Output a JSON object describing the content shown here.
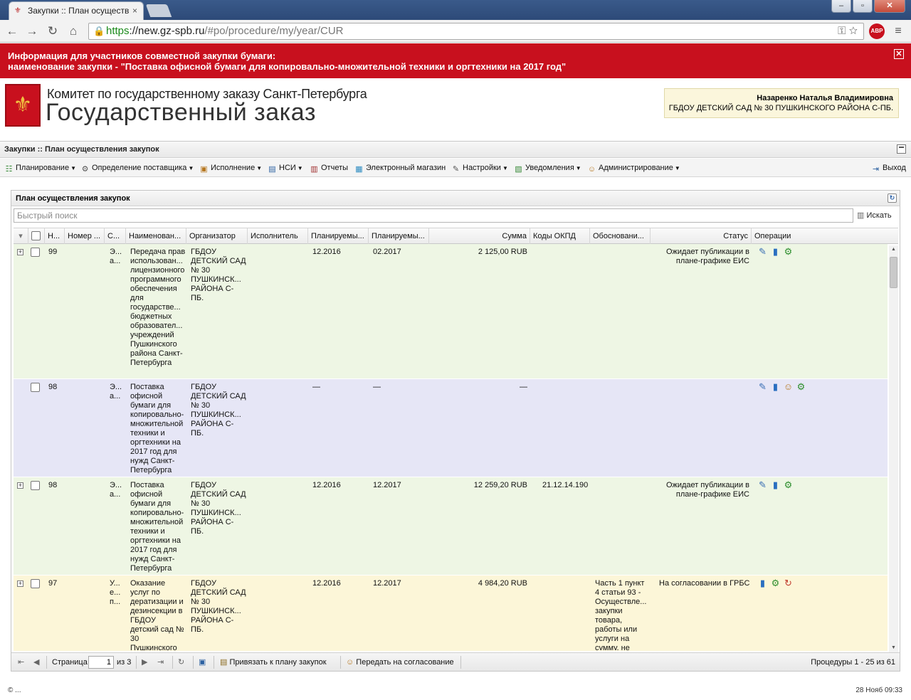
{
  "browser": {
    "tab_title": "Закупки :: План осуществ",
    "tab_close": "×",
    "favicon": "⚜",
    "url_https": "https",
    "url_host": "://new.gz-spb.ru",
    "url_path": "/#po/procedure/my/year/CUR",
    "abp_label": "ABP",
    "window_controls": {
      "minimize": "–",
      "maximize": "▫",
      "close": "✕"
    },
    "icons": {
      "back": "←",
      "forward": "→",
      "reload": "↻",
      "home": "⌂",
      "menu": "≡",
      "lock": "🔒",
      "key": "⚿",
      "star": "☆"
    }
  },
  "banner": {
    "line1": "Информация для участников совместной закупки бумаги:",
    "line2": "наименование закупки - \"Поставка офисной бумаги для копировально-множительной техники и оргтехники на 2017 год\"",
    "close": "✕"
  },
  "header": {
    "logo_glyph": "⚜",
    "line1": "Комитет по государственному заказу Санкт-Петербурга",
    "line2": "Государственный заказ",
    "user_name": "Назаренко Наталья Владимировна",
    "user_org": "ГБДОУ ДЕТСКИЙ САД № 30 ПУШКИНСКОГО РАЙОНА С-ПБ."
  },
  "panel": {
    "title": "Закупки :: План осуществления закупок"
  },
  "menu": {
    "items": [
      {
        "label": "Планирование",
        "icon": "☷"
      },
      {
        "label": "Определение поставщика",
        "icon": "⚙"
      },
      {
        "label": "Исполнение",
        "icon": "▣"
      },
      {
        "label": "НСИ",
        "icon": "▤"
      },
      {
        "label": "Отчеты",
        "icon": "▥"
      },
      {
        "label": "Электронный магазин",
        "icon": "▦"
      },
      {
        "label": "Настройки",
        "icon": "✎"
      },
      {
        "label": "Уведомления",
        "icon": "▧"
      },
      {
        "label": "Администрирование",
        "icon": "☺"
      }
    ],
    "logout": "Выход",
    "logout_icon": "⇥"
  },
  "grid": {
    "title": "План осуществления закупок",
    "refresh_icon": "↻",
    "search_placeholder": "Быстрый поиск",
    "search_button": "Искать",
    "search_icon": "▥",
    "filter_icon": "▾",
    "columns": [
      "Н...",
      "Номер ...",
      "С...",
      "Наименован...",
      "Организатор",
      "Исполнитель",
      "Планируемы...",
      "Планируемы...",
      "Сумма",
      "Коды ОКПД",
      "Обосновани...",
      "Статус",
      "Операции"
    ],
    "rows": [
      {
        "expander": "+",
        "color": "green",
        "num": "99",
        "short": "Э... а...",
        "name": "Передача прав использован... лицензионного программного обеспечения для государстве... бюджетных образовател... учреждений Пушкинского района Санкт-Петербурга",
        "org": "ГБДОУ ДЕТСКИЙ САД № 30 ПУШКИНСК... РАЙОНА С-ПБ.",
        "plan1": "12.2016",
        "plan2": "02.2017",
        "sum": "2 125,00 RUB",
        "okpd": "",
        "basis": "",
        "status": "Ожидает публикации в плане-графике ЕИС",
        "ops": [
          [
            "op-edit",
            "✎"
          ],
          [
            "op-chart",
            "▮"
          ],
          [
            "op-gear",
            "⚙"
          ]
        ]
      },
      {
        "expander": "",
        "color": "blue",
        "num": "98",
        "short": "Э... а...",
        "name": "Поставка офисной бумаги для копировально-множительной техники и оргтехники на 2017 год для нужд Санкт-Петербурга",
        "org": "ГБДОУ ДЕТСКИЙ САД № 30 ПУШКИНСК... РАЙОНА С-ПБ.",
        "plan1": "—",
        "plan2": "—",
        "sum": "—",
        "okpd": "",
        "basis": "",
        "status": "",
        "ops": [
          [
            "op-edit",
            "✎"
          ],
          [
            "op-chart",
            "▮"
          ],
          [
            "op-user",
            "☺"
          ],
          [
            "op-gear",
            "⚙"
          ]
        ]
      },
      {
        "expander": "+",
        "color": "green",
        "num": "98",
        "short": "Э... а...",
        "name": "Поставка офисной бумаги для копировально-множительной техники и оргтехники на 2017 год для нужд Санкт-Петербурга",
        "org": "ГБДОУ ДЕТСКИЙ САД № 30 ПУШКИНСК... РАЙОНА С-ПБ.",
        "plan1": "12.2016",
        "plan2": "12.2017",
        "sum": "12 259,20 RUB",
        "okpd": "21.12.14.190",
        "basis": "",
        "status": "Ожидает публикации в плане-графике ЕИС",
        "ops": [
          [
            "op-edit",
            "✎"
          ],
          [
            "op-chart",
            "▮"
          ],
          [
            "op-gear",
            "⚙"
          ]
        ]
      },
      {
        "expander": "+",
        "color": "yellow",
        "num": "97",
        "short": "У... е... п...",
        "name": "Оказание услуг по дератизации и дезинсекции в ГБДОУ детский сад № 30 Пушкинского",
        "org": "ГБДОУ ДЕТСКИЙ САД № 30 ПУШКИНСК... РАЙОНА С-ПБ.",
        "plan1": "12.2016",
        "plan2": "12.2017",
        "sum": "4 984,20 RUB",
        "okpd": "",
        "basis": "Часть 1 пункт 4 статьи 93 - Осуществле... закупки товара, работы или услуги на сумму, не",
        "status": "На согласовании в ГРБС",
        "ops": [
          [
            "op-chart",
            "▮"
          ],
          [
            "op-gear",
            "⚙"
          ],
          [
            "op-undo",
            "↻"
          ]
        ]
      }
    ]
  },
  "paging": {
    "page_label": "Страница",
    "page_value": "1",
    "of_label": "из 3",
    "bind_button": "Привязать к плану закупок",
    "send_button": "Передать на согласование",
    "summary": "Процедуры 1 - 25 из 61",
    "icons": {
      "first": "⇤",
      "prev": "◀",
      "next": "▶",
      "last": "⇥",
      "refresh": "↻",
      "save": "▣",
      "bind": "▤",
      "send": "☺"
    }
  },
  "footer": {
    "left": "© ...",
    "right": "28 Нояб 09:33"
  }
}
